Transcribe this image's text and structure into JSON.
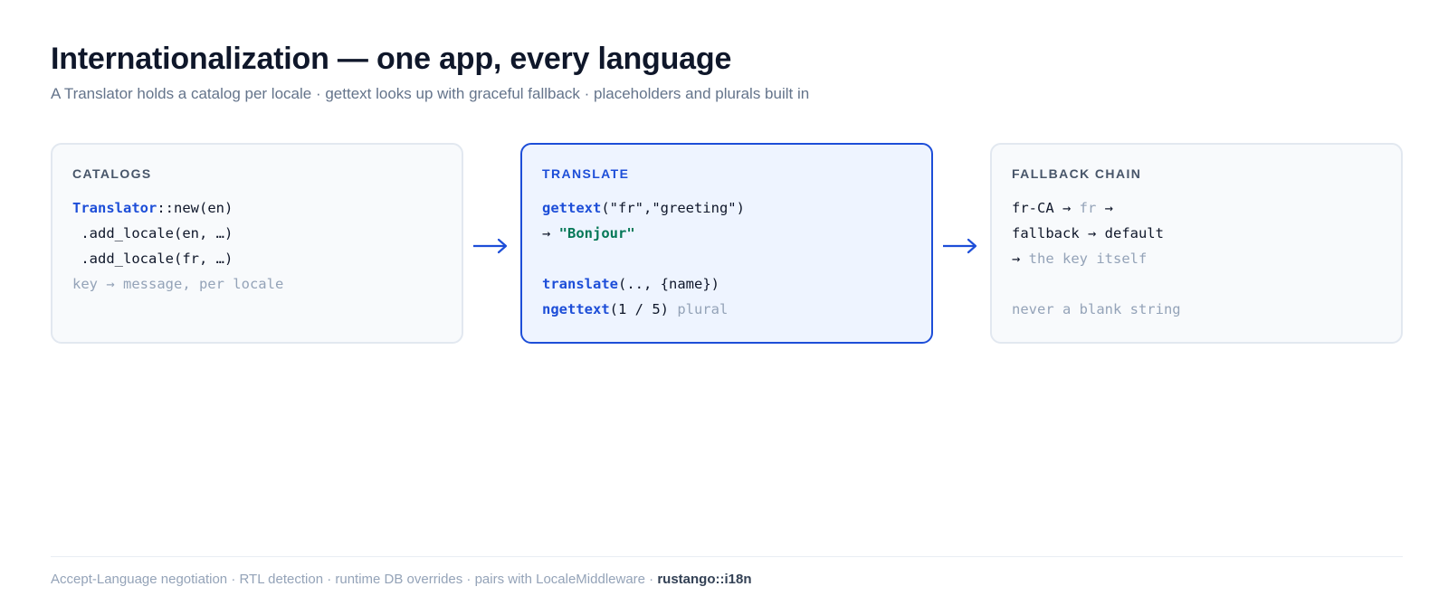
{
  "header": {
    "title": "Internationalization — one app, every language",
    "subtitle": "A Translator holds a catalog per locale · gettext looks up with graceful fallback · placeholders and plurals built in"
  },
  "panels": [
    {
      "title": "CATALOGS",
      "lines": [
        [
          {
            "text": "Translator",
            "style": "kw"
          },
          {
            "text": "::new(en)",
            "style": "plain"
          }
        ],
        [
          {
            "text": " .add_locale(en, …)",
            "style": "plain"
          }
        ],
        [
          {
            "text": " .add_locale(fr, …)",
            "style": "plain"
          }
        ],
        [
          {
            "text": "key → message, per locale",
            "style": "muted"
          }
        ]
      ]
    },
    {
      "title": "TRANSLATE",
      "lines": [
        [
          {
            "text": "gettext",
            "style": "kw"
          },
          {
            "text": "(\"fr\",\"greeting\")",
            "style": "plain"
          }
        ],
        [
          {
            "text": "→ ",
            "style": "plain"
          },
          {
            "text": "\"Bonjour\"",
            "style": "str"
          }
        ],
        [],
        [
          {
            "text": "translate",
            "style": "kw"
          },
          {
            "text": "(.., {name})",
            "style": "plain"
          }
        ],
        [
          {
            "text": "ngettext",
            "style": "kw"
          },
          {
            "text": "(1 / 5) ",
            "style": "plain"
          },
          {
            "text": "plural",
            "style": "muted"
          }
        ]
      ]
    },
    {
      "title": "FALLBACK CHAIN",
      "lines": [
        [
          {
            "text": "fr-CA → ",
            "style": "plain"
          },
          {
            "text": "fr",
            "style": "muted"
          },
          {
            "text": " →",
            "style": "plain"
          }
        ],
        [
          {
            "text": "fallback → default",
            "style": "plain"
          }
        ],
        [
          {
            "text": "→ ",
            "style": "plain"
          },
          {
            "text": "the key itself",
            "style": "muted"
          }
        ],
        [],
        [
          {
            "text": "never a blank string",
            "style": "muted"
          }
        ]
      ]
    }
  ],
  "footer": {
    "text": "Accept-Language negotiation · RTL detection · runtime DB overrides · pairs with LocaleMiddleware · ",
    "brand": "rustango::i18n"
  },
  "colors": {
    "accent": "#1d4ed8",
    "string": "#047857",
    "muted": "#94a3b8",
    "text": "#0f172a",
    "panel_border": "#e2e8f0",
    "panel_bg": "#f8fafc",
    "active_panel_bg": "#eef4ff"
  },
  "icons": {
    "connector": "right-arrow-icon"
  }
}
